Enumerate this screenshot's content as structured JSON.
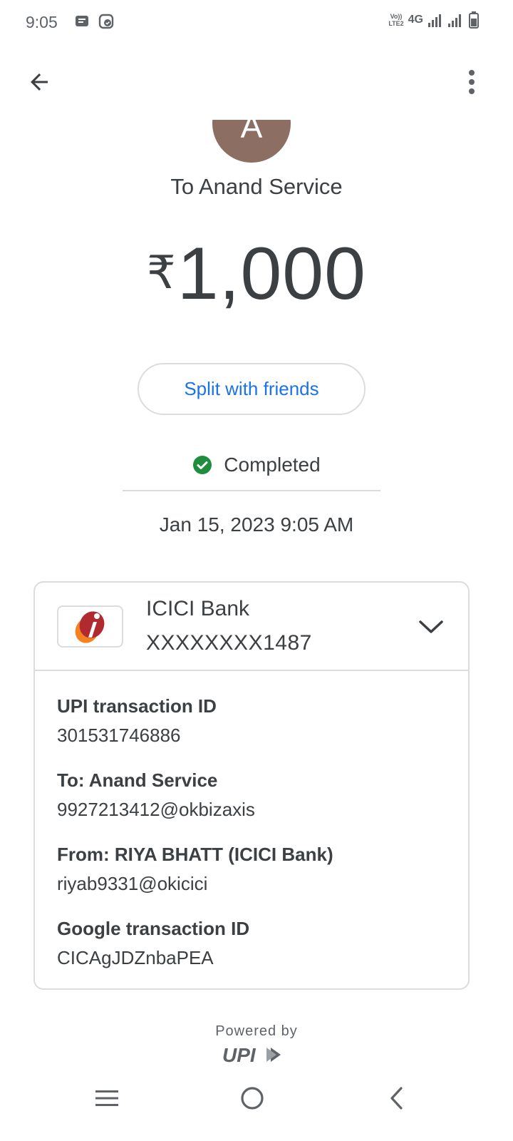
{
  "status_bar": {
    "time": "9:05",
    "network": "4G",
    "volte_line1": "Vo))",
    "volte_line2": "LTE2"
  },
  "app_bar": {
    "back_icon": "arrow-back-icon",
    "more_icon": "more-vert-icon"
  },
  "payee": {
    "avatar_initial": "A",
    "avatar_color": "#8d6e63",
    "title": "To Anand Service"
  },
  "amount": {
    "currency": "₹",
    "value": "1,000"
  },
  "split_button": {
    "label": "Split with friends",
    "color": "#1a73e8"
  },
  "status": {
    "text": "Completed",
    "color": "#1e8e3e",
    "datetime": "Jan 15, 2023 9:05 AM"
  },
  "account": {
    "bank_name": "ICICI Bank",
    "account_number": "XXXXXXXX1487"
  },
  "details": [
    {
      "label": "UPI transaction ID",
      "value": "301531746886"
    },
    {
      "label": "To: Anand Service",
      "value": "9927213412@okbizaxis"
    },
    {
      "label": "From: RIYA BHATT (ICICI Bank)",
      "value": "riyab9331@okicici"
    },
    {
      "label": "Google transaction ID",
      "value": "CICAgJDZnbaPEA"
    }
  ],
  "footer": {
    "powered_by": "Powered by",
    "upi_text": "UPI"
  },
  "nav_bar": {
    "recents_icon": "recents-icon",
    "home_icon": "home-icon",
    "back_icon": "nav-back-icon"
  }
}
